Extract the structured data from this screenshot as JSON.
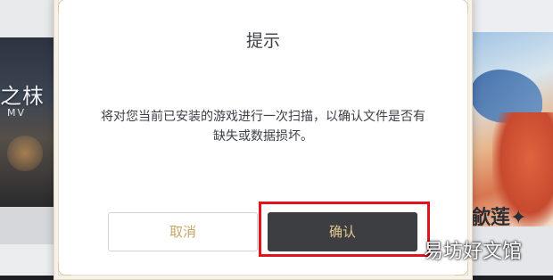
{
  "background": {
    "left_art_title": "之枺",
    "left_art_subtitle": "MV",
    "right_char_name": "歈莲",
    "right_char_symbol": "✦"
  },
  "dialog": {
    "title": "提示",
    "message": "将对您当前已安装的游戏进行一次扫描，以确认文件是否有缺失或数据损坏。",
    "cancel_label": "取消",
    "confirm_label": "确认"
  },
  "watermark": "易坊好文馆",
  "colors": {
    "highlight": "#e3121c",
    "confirm_bg": "#3d3e42",
    "confirm_text": "#e7c98f",
    "cancel_text": "#c9a66a"
  }
}
